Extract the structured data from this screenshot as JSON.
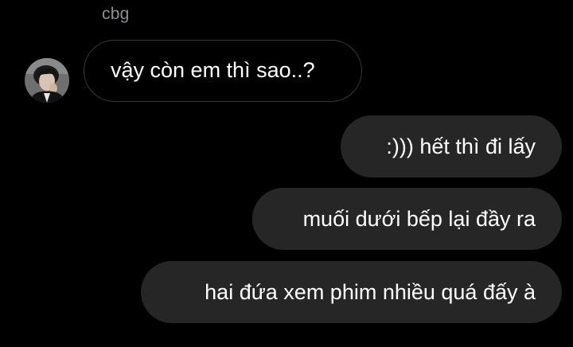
{
  "thread": {
    "sender_name": "cbg"
  },
  "messages": [
    {
      "direction": "incoming",
      "text": "vậy còn em thì sao..?"
    },
    {
      "direction": "outgoing",
      "text": ":))) hết thì đi lấy"
    },
    {
      "direction": "outgoing",
      "text": "muối dưới bếp lại đầy ra"
    },
    {
      "direction": "outgoing",
      "text": "hai đứa xem phim nhiều quá đấy à"
    }
  ],
  "colors": {
    "background": "#000000",
    "outgoing_bubble": "#262626",
    "incoming_border": "#3a3a3c",
    "secondary_text": "#8e8e93"
  }
}
